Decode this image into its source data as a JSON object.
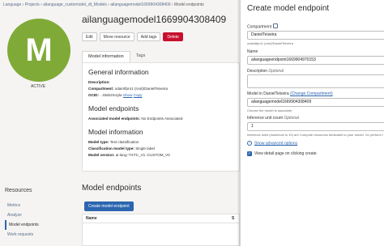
{
  "breadcrumb": {
    "items": [
      "Language",
      "Projects",
      "ailanguage_customodel_dt_Models",
      "ailanguagemodel1669904308409"
    ],
    "separator": " › ",
    "current": "Model endpoints"
  },
  "model": {
    "avatar_letter": "M",
    "avatar_color": "#80aa37",
    "status": "ACTIVE",
    "title": "ailanguagemodel1669904308409"
  },
  "actions": {
    "edit": "Edit",
    "move": "Move resource",
    "add_tags": "Add tags",
    "delete": "Delete"
  },
  "tabs": [
    "Model information",
    "Tags"
  ],
  "general_info": {
    "heading": "General information",
    "description_label": "Description:",
    "compartment_label": "Compartment:",
    "compartment_value": "odaintfpro1 (root)/DanielTeixeira",
    "ocid_label": "OCID:",
    "ocid_value": "...6teb2mzyla",
    "ocid_show": "Show",
    "ocid_copy": "Copy"
  },
  "model_endpoints_info": {
    "heading": "Model endpoints",
    "label": "Associated model endpoints:",
    "value": "No Endpoints Associated"
  },
  "model_info": {
    "heading": "Model information",
    "type_label": "Model type:",
    "type_value": "Text classification",
    "mode_label": "Classification model type:",
    "mode_value": "Single label",
    "version_label": "Model version:",
    "version_value": "ai-lang::TXTC_V1::CUSTOM_V0"
  },
  "resources": {
    "title": "Resources",
    "items": [
      "Metrics",
      "Analyze",
      "Model endpoints",
      "Work requests"
    ],
    "selected_index": 2
  },
  "endpoints_section": {
    "title": "Model endpoints",
    "create_button": "Create model endpoint",
    "table_headers": [
      "Name",
      "S"
    ]
  },
  "panel": {
    "title": "Create model endpoint",
    "compartment_label": "Compartment",
    "compartment_value": "DanielTeixeira",
    "compartment_help": "odaintfpro1 (root)/DanielTeixeira",
    "name_label": "Name",
    "name_value": "ailanguageendpoint1669904970153",
    "description_label": "Description",
    "optional": "Optional",
    "model_label": "Model in DanielTeixeira",
    "change_compartment": "(Change Compartment)",
    "model_value": "ailanguagemodel1669904308409",
    "model_help": "Choose the model to associate.",
    "inference_label": "Inference unit count",
    "inference_value": "1",
    "inference_help": "Inference units (maximum is 10) are Compute resources dedicated to your model. 1U perform inferen",
    "advanced_link": "Show advanced options",
    "checkbox_label": "View detail page on clicking create",
    "checkbox_checked": true
  },
  "colors": {
    "primary": "#2c66b0",
    "danger": "#c8102e",
    "avatar_green": "#80aa37"
  }
}
